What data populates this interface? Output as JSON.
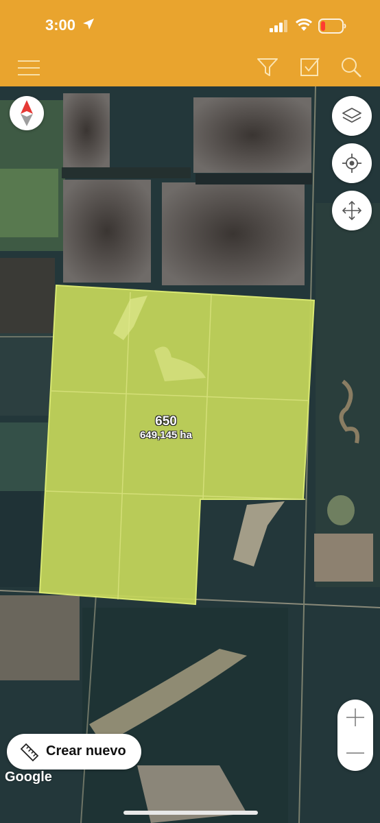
{
  "status_bar": {
    "time": "3:00",
    "icons": [
      "location-arrow-icon",
      "signal-icon",
      "wifi-icon",
      "battery-icon"
    ]
  },
  "toolbar": {
    "icons": [
      "menu-icon",
      "filter-icon",
      "checkbox-icon",
      "search-icon"
    ]
  },
  "map": {
    "polygon": {
      "id": "650",
      "area": "649,145 ha"
    },
    "map_controls": [
      "compass-icon",
      "layers-icon",
      "locate-icon",
      "move-icon",
      "zoom-in-icon",
      "zoom-out-icon"
    ],
    "attribution": "Google"
  },
  "actions": {
    "create_label": "Crear nuevo",
    "create_icon": "ruler-icon"
  },
  "colors": {
    "header": "#e9a42e",
    "polygon_fill": "#c5d65a",
    "polygon_stroke": "#d9e872",
    "accent_red": "#e53935"
  }
}
